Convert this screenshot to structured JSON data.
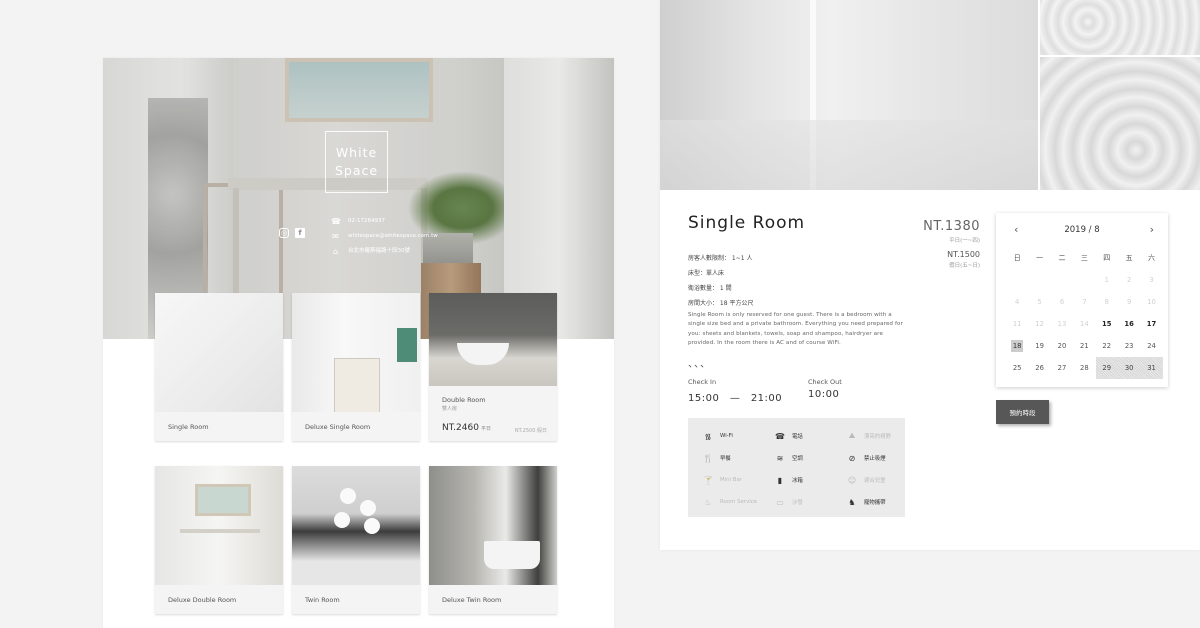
{
  "home": {
    "brand_line1": "White",
    "brand_line2": "Space",
    "social": [
      "instagram-icon",
      "facebook-icon"
    ],
    "phone": "02-17264937",
    "email": "whitespace@whitespace.com.tw",
    "address": "台北市羅斯福路十段30號",
    "rooms": [
      {
        "name": "Single Room"
      },
      {
        "name": "Deluxe Single Room"
      },
      {
        "name": "Double Room",
        "subtitle": "雙人房",
        "price": "NT.2460",
        "price_note": "平日",
        "price2": "NT.2500 假日"
      },
      {
        "name": "Deluxe Double Room"
      },
      {
        "name": "Twin Room"
      },
      {
        "name": "Deluxe Twin Room"
      }
    ]
  },
  "detail": {
    "title": "Single Room",
    "price_weekday": "NT.1380",
    "price_weekday_note": "平日(一~四)",
    "price_weekend": "NT.1500",
    "price_weekend_note": "假日(五~日)",
    "specs": [
      "房客人數限制： 1~1 人",
      "床型：單人床",
      "衛浴數量： 1 間",
      "房間大小： 18 平方公尺"
    ],
    "description": "Single Room is only reserved for one guest. There is a bedroom with a single size bed and a private bathroom. Everything you need prepared for you: sheets and blankets, towels, soap and shampoo, hairdryer are provided. In the room there is AC and of course WiFi.",
    "dots": "、、、",
    "check_in_label": "Check In",
    "check_in_time": "15:00　—　21:00",
    "check_out_label": "Check Out",
    "check_out_time": "10:00",
    "amenities": [
      {
        "label": "Wi-Fi",
        "icon": "wifi-icon",
        "available": true
      },
      {
        "label": "電話",
        "icon": "phone-icon",
        "available": true
      },
      {
        "label": "漂亮的視野",
        "icon": "view-icon",
        "available": false
      },
      {
        "label": "早餐",
        "icon": "breakfast-icon",
        "available": true
      },
      {
        "label": "空調",
        "icon": "air-conditioner-icon",
        "available": true
      },
      {
        "label": "禁止吸煙",
        "icon": "no-smoking-icon",
        "available": true
      },
      {
        "label": "Mini Bar",
        "icon": "minibar-icon",
        "available": false
      },
      {
        "label": "冰箱",
        "icon": "fridge-icon",
        "available": true
      },
      {
        "label": "適合兒童",
        "icon": "child-friendly-icon",
        "available": false
      },
      {
        "label": "Room Service",
        "icon": "room-service-icon",
        "available": false
      },
      {
        "label": "沙發",
        "icon": "sofa-icon",
        "available": false
      },
      {
        "label": "寵物攜帶",
        "icon": "pet-icon",
        "available": true
      }
    ],
    "calendar": {
      "month_label": "2019 / 8",
      "weekdays": [
        "日",
        "一",
        "二",
        "三",
        "四",
        "五",
        "六"
      ],
      "leading_blanks": 4,
      "days": [
        1,
        2,
        3,
        4,
        5,
        6,
        7,
        8,
        9,
        10,
        11,
        12,
        13,
        14,
        15,
        16,
        17,
        18,
        19,
        20,
        21,
        22,
        23,
        24,
        25,
        26,
        27,
        28,
        29,
        30,
        31
      ],
      "past_until": 14,
      "selected": 18,
      "booked": [
        29,
        30,
        31
      ]
    },
    "book_button": "預約時段"
  }
}
